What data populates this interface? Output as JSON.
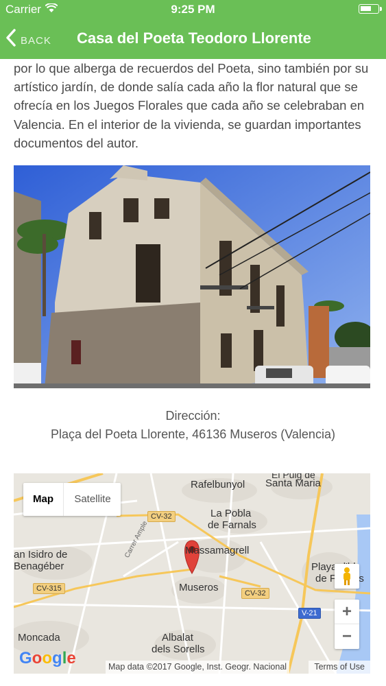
{
  "status_bar": {
    "carrier": "Carrier",
    "time": "9:25 PM",
    "wifi_icon": "wifi-icon",
    "battery_icon": "battery-icon"
  },
  "nav": {
    "back_label": "BACK",
    "title": "Casa del Poeta Teodoro Llorente"
  },
  "description": "por lo que alberga de recuerdos del Poeta, sino también por su artístico jardín, de donde salía cada año la flor natural que se ofrecía en los Juegos Florales que cada año se celebraban en Valencia. En el interior de la vivienda, se guardan importantes documentos del autor.",
  "address": {
    "label": "Dirección:",
    "value": "Plaça del Poeta Llorente, 46136 Museros (Valencia)"
  },
  "map": {
    "type_toggle": {
      "map_label": "Map",
      "satellite_label": "Satellite"
    },
    "places": {
      "rafelbunyol": "Rafelbunyol",
      "puig_1": "El Puig de",
      "puig_2": "Santa Maria",
      "pobla_1": "La Pobla",
      "pobla_2": "de Farnals",
      "massamagrell": "Massamagrell",
      "san_isidro_1": "an Isidro de",
      "san_isidro_2": "Benagéber",
      "museros": "Museros",
      "moncada": "Moncada",
      "albalat_1": "Albalat",
      "albalat_2": "dels Sorells",
      "playa_1": "Playa d'bl",
      "playa_2": "de Farnals",
      "carrer_ample": "Carrer Ample"
    },
    "roads": {
      "cv32_a": "CV-32",
      "cv32_b": "CV-32",
      "cv315": "CV-315",
      "v21": "V-21"
    },
    "zoom_in": "+",
    "zoom_out": "−",
    "logo": "Google",
    "attribution": "Map data ©2017 Google, Inst. Geogr. Nacional",
    "terms": "Terms of Use"
  }
}
